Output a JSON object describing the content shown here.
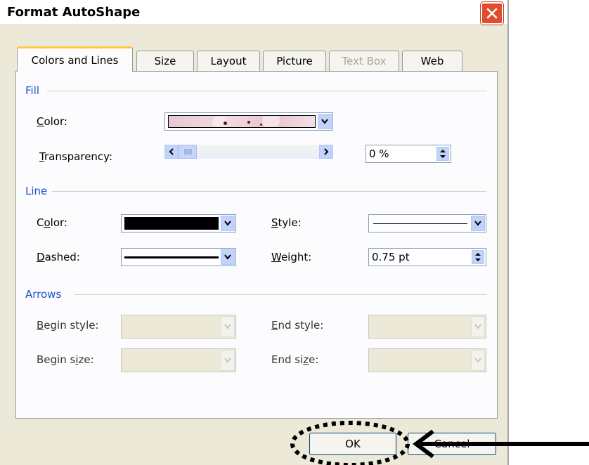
{
  "window": {
    "title": "Format AutoShape"
  },
  "tabs": [
    {
      "label": "Colors and Lines"
    },
    {
      "label": "Size"
    },
    {
      "label": "Layout"
    },
    {
      "label": "Picture"
    },
    {
      "label": "Text Box"
    },
    {
      "label": "Web"
    }
  ],
  "fill": {
    "section_label": "Fill",
    "color_label_key": "C",
    "color_label_rest": "olor:",
    "transparency_label_key": "T",
    "transparency_label_rest": "ransparency:",
    "transparency_value": "0 %"
  },
  "line": {
    "section_label": "Line",
    "color_label_pre": "C",
    "color_label_key": "o",
    "color_label_rest": "lor:",
    "dashed_label_key": "D",
    "dashed_label_rest": "ashed:",
    "style_label_key": "S",
    "style_label_rest": "tyle:",
    "weight_label_key": "W",
    "weight_label_rest": "eight:",
    "weight_value": "0.75 pt"
  },
  "arrows": {
    "section_label": "Arrows",
    "begin_style_label_key": "B",
    "begin_style_label_rest": "egin style:",
    "begin_size_label_pre": "Begin s",
    "begin_size_label_key": "i",
    "begin_size_label_rest": "ze:",
    "end_style_label_key": "E",
    "end_style_label_rest": "nd style:",
    "end_size_label_pre": "End si",
    "end_size_label_key": "z",
    "end_size_label_rest": "e:"
  },
  "buttons": {
    "ok": "OK",
    "cancel": "Cancel"
  },
  "colors": {
    "accent": "#1b53c8",
    "tab_highlight": "#ffc83c",
    "close": "#e14b2e",
    "line_color": "#000000"
  }
}
